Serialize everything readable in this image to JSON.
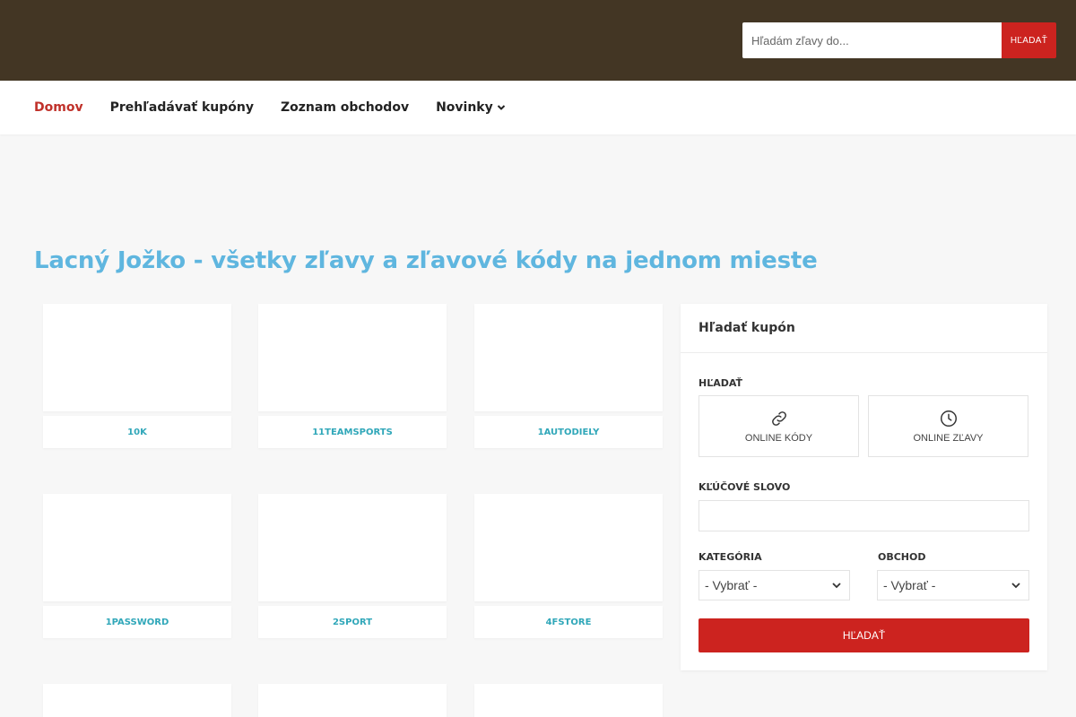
{
  "header": {
    "search_placeholder": "Hľadám zľavy do...",
    "search_button": "HĽADAŤ",
    "bg_color": "#433624",
    "button_color": "#cc231f"
  },
  "nav": {
    "items": [
      {
        "label": "Domov",
        "active": true
      },
      {
        "label": "Prehľadávať kupóny",
        "active": false
      },
      {
        "label": "Zoznam obchodov",
        "active": false
      },
      {
        "label": "Novinky",
        "active": false,
        "dropdown": true
      }
    ],
    "active_color": "#c0312a"
  },
  "page": {
    "title": "Lacný Jožko - všetky zľavy a zľavové kódy na jednom mieste",
    "title_color": "#5fb6df"
  },
  "stores": [
    {
      "name": "10K"
    },
    {
      "name": "11TEAMSPORTS"
    },
    {
      "name": "1AUTODIELY"
    },
    {
      "name": "1PASSWORD"
    },
    {
      "name": "2SPORT"
    },
    {
      "name": "4FSTORE"
    },
    {
      "name": ""
    },
    {
      "name": ""
    },
    {
      "name": ""
    }
  ],
  "sidebar": {
    "title": "Hľadať kupón",
    "search_label": "HĽADAŤ",
    "options": [
      {
        "label": "ONLINE KÓDY",
        "icon": "link-icon"
      },
      {
        "label": "ONLINE ZĽAVY",
        "icon": "clock-icon"
      }
    ],
    "keyword_label": "KĽÚČOVÉ SLOVO",
    "keyword_value": "",
    "category_label": "KATEGÓRIA",
    "category_value": "- Vybrať -",
    "store_label": "OBCHOD",
    "store_value": "- Vybrať -",
    "submit_label": "HĽADAŤ",
    "submit_color": "#cc231f"
  }
}
